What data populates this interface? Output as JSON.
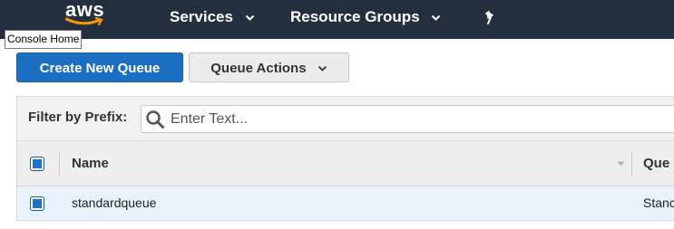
{
  "nav": {
    "logo_text": "aws",
    "services_label": "Services",
    "resource_groups_label": "Resource Groups",
    "pin_icon": "pin-icon",
    "caret_icon": "chevron-down-icon"
  },
  "tooltip": {
    "text": "Console Home"
  },
  "toolbar": {
    "create_label": "Create New Queue",
    "actions_label": "Queue Actions"
  },
  "filter": {
    "label": "Filter by Prefix:",
    "placeholder": "Enter Text...",
    "value": ""
  },
  "table": {
    "columns": [
      "Name",
      "Que"
    ],
    "rows": [
      {
        "name": "standardqueue",
        "type": "Stanc"
      }
    ]
  },
  "colors": {
    "nav_bg": "#232f3e",
    "primary": "#1a6fc2",
    "selected_row_bg": "#eaf3fc",
    "checkbox": "#1a73c7"
  }
}
